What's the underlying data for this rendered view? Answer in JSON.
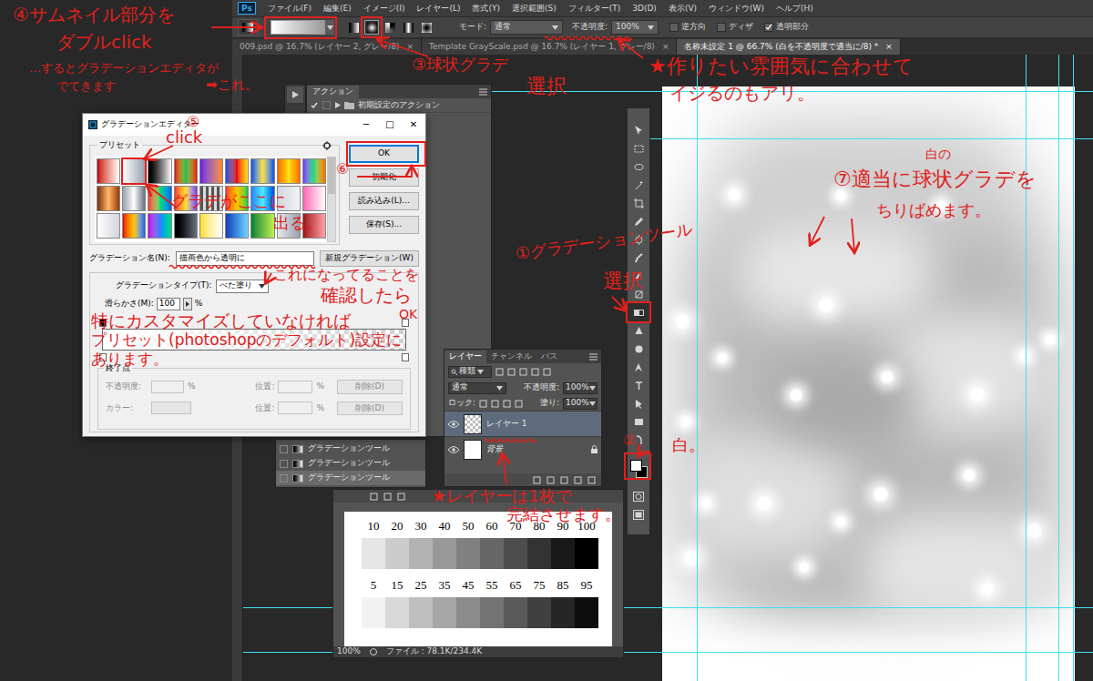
{
  "app": {
    "logo": "Ps",
    "menu": [
      "ファイル(F)",
      "編集(E)",
      "イメージ(I)",
      "レイヤー(L)",
      "書式(Y)",
      "選択範囲(S)",
      "フィルター(T)",
      "3D(D)",
      "表示(V)",
      "ウィンドウ(W)",
      "ヘルプ(H)"
    ]
  },
  "options_bar": {
    "gradient_types": [
      {
        "selected": false
      },
      {
        "selected": true
      },
      {
        "selected": false
      },
      {
        "selected": false
      },
      {
        "selected": false
      }
    ],
    "mode_label": "モード:",
    "mode": "通常",
    "opacity_label": "不透明度:",
    "opacity": "100%",
    "checkboxes": [
      {
        "label": "逆方向",
        "checked": false
      },
      {
        "label": "ディザ",
        "checked": false
      },
      {
        "label": "透明部分",
        "checked": true
      }
    ]
  },
  "doc_tabs": [
    {
      "label": "009.psd @ 16.7% (レイヤー 2, グレー/8)",
      "close": "×",
      "selected": false
    },
    {
      "label": "Template GrayScale.psd @ 16.7% (レイヤー 1, グレー/8)",
      "close": "×",
      "selected": false
    },
    {
      "label": "名称未設定 1 @ 66.7% (白を不透明度で適当に/8) *",
      "close": "×",
      "selected": true
    }
  ],
  "actions_panel": {
    "tab": "アクション",
    "items": [
      {
        "label": "初期設定のアクション",
        "checked": true,
        "expanded": false
      }
    ]
  },
  "history_panel": {
    "items": [
      {
        "label": "グラデーションツール",
        "selected": false
      },
      {
        "label": "グラデーションツール",
        "selected": false
      },
      {
        "label": "グラデーションツール",
        "selected": true
      }
    ]
  },
  "gradient_editor": {
    "title": "グラデーションエディター",
    "controls": [
      "─",
      "□",
      "✕"
    ],
    "presets_label": "プリセット",
    "presets": [
      {
        "selected": false
      },
      {
        "selected": true
      },
      {
        "selected": false
      },
      {
        "selected": false
      },
      {
        "selected": false
      },
      {
        "selected": false
      },
      {
        "selected": false
      },
      {
        "selected": false
      },
      {
        "selected": false
      },
      {
        "selected": false
      },
      {
        "selected": false
      },
      {
        "selected": false
      },
      {
        "selected": false
      },
      {
        "selected": false
      },
      {
        "selected": false
      },
      {
        "selected": false
      },
      {
        "selected": false
      },
      {
        "selected": false
      },
      {
        "selected": false
      },
      {
        "selected": false
      },
      {
        "selected": false
      },
      {
        "selected": false
      },
      {
        "selected": false
      },
      {
        "selected": false
      },
      {
        "selected": false
      },
      {
        "selected": false
      },
      {
        "selected": false
      }
    ],
    "buttons": [
      {
        "label": "OK",
        "focused": true
      },
      {
        "label": "初期化",
        "focused": false
      },
      {
        "label": "読み込み(L)...",
        "focused": false
      },
      {
        "label": "保存(S)...",
        "focused": false
      }
    ],
    "name_label": "グラデーション名(N):",
    "name": "描画色から透明に",
    "new_button": "新規グラデーション(W)",
    "type_label": "グラデーションタイプ(T):",
    "type": "べた塗り",
    "smooth_label": "滑らかさ(M):",
    "smooth": "100",
    "smooth_unit": "%",
    "stops_label": "終了点",
    "stop_rows": [
      {
        "kind": "number",
        "label": "不透明度:",
        "unit": "%",
        "position_label": "位置:",
        "position_unit": "%",
        "delete": "削除(D)",
        "disabled": true
      },
      {
        "kind": "color",
        "label": "カラー:",
        "position_label": "位置:",
        "position_unit": "%",
        "delete": "削除(D)",
        "disabled": true
      }
    ]
  },
  "layers_panel": {
    "tabs": [
      {
        "label": "レイヤー",
        "selected": true
      },
      {
        "label": "チャンネル",
        "selected": false
      },
      {
        "label": "パス",
        "selected": false
      }
    ],
    "filter": "種類",
    "blend": "通常",
    "opacity_label": "不透明度:",
    "opacity": "100%",
    "lock_label": "ロック:",
    "fill_label": "塗り:",
    "fill": "100%",
    "layers": [
      {
        "name": "レイヤー 1",
        "kind": "transparent",
        "selected": true,
        "visible": true,
        "locked": false
      },
      {
        "name": "背景",
        "kind": "white",
        "selected": false,
        "visible": true,
        "locked": true
      }
    ]
  },
  "gray_chart": {
    "rows": [
      {
        "swatches": [
          {
            "label": "10",
            "level": 0.1
          },
          {
            "label": "20",
            "level": 0.2
          },
          {
            "label": "30",
            "level": 0.3
          },
          {
            "label": "40",
            "level": 0.4
          },
          {
            "label": "50",
            "level": 0.5
          },
          {
            "label": "60",
            "level": 0.6
          },
          {
            "label": "70",
            "level": 0.7
          },
          {
            "label": "80",
            "level": 0.8
          },
          {
            "label": "90",
            "level": 0.9
          },
          {
            "label": "100",
            "level": 1.0
          }
        ]
      },
      {
        "swatches": [
          {
            "label": "5",
            "level": 0.05
          },
          {
            "label": "15",
            "level": 0.15
          },
          {
            "label": "25",
            "level": 0.25
          },
          {
            "label": "35",
            "level": 0.35
          },
          {
            "label": "45",
            "level": 0.45
          },
          {
            "label": "55",
            "level": 0.55
          },
          {
            "label": "65",
            "level": 0.65
          },
          {
            "label": "75",
            "level": 0.75
          },
          {
            "label": "85",
            "level": 0.85
          },
          {
            "label": "95",
            "level": 0.95
          }
        ]
      }
    ],
    "zoom": "100%",
    "file_info": "ファイル : 78.1K/234.4K"
  },
  "tools": {
    "items": [
      {
        "selected": false
      },
      {
        "selected": false
      },
      {
        "selected": false
      },
      {
        "selected": false
      },
      {
        "selected": false
      },
      {
        "selected": false
      },
      {
        "selected": false
      },
      {
        "selected": false
      },
      {
        "selected": false
      },
      {
        "selected": false
      },
      {
        "selected": true
      },
      {
        "selected": false
      },
      {
        "selected": false
      },
      {
        "selected": false
      },
      {
        "selected": false
      },
      {
        "selected": false
      },
      {
        "selected": false
      },
      {
        "selected": false
      }
    ],
    "foreground": "#ffffff",
    "background": "#000000"
  },
  "annotations": [
    "④サムネイル部分を",
    "ダブルclick",
    "…するとグラデーションエディタが",
    "でてきます",
    "➡これ。",
    "③球状グラデ",
    "選択",
    "★作りたい雰囲気に合わせて",
    "イジるのもアリ。",
    "⑤",
    "click",
    "⑥",
    "グラデがここに",
    "出る。",
    "これになってることを",
    "確認したら",
    "OK",
    "特にカスタマイズしていなければ",
    "プリセット(photoshopのデフォルト)設定に",
    "あります。",
    "①グラデーションツール",
    "選択",
    "②",
    "白。",
    "白の",
    "⑦適当に球状グラデを",
    "ちりばめます。",
    "★レイヤーは1枚で",
    "完結させます。"
  ]
}
